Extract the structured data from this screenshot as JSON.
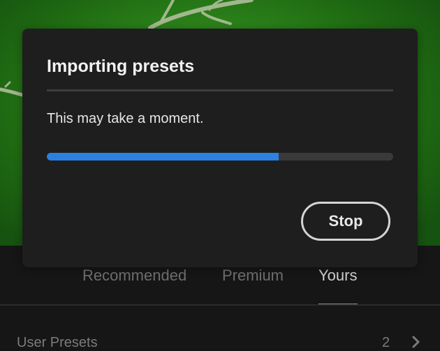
{
  "dialog": {
    "title": "Importing presets",
    "message": "This may take a moment.",
    "progress": 0.67,
    "stop_label": "Stop"
  },
  "presets": {
    "tabs": [
      {
        "label": "Recommended",
        "active": false
      },
      {
        "label": "Premium",
        "active": false
      },
      {
        "label": "Yours",
        "active": true
      }
    ],
    "rows": [
      {
        "label": "User Presets",
        "count": "2",
        "icon": "chevron-right-icon"
      }
    ]
  },
  "colors": {
    "accent": "#2c80e0",
    "dialog_bg": "#1e1e1e",
    "panel_bg": "#161616"
  }
}
